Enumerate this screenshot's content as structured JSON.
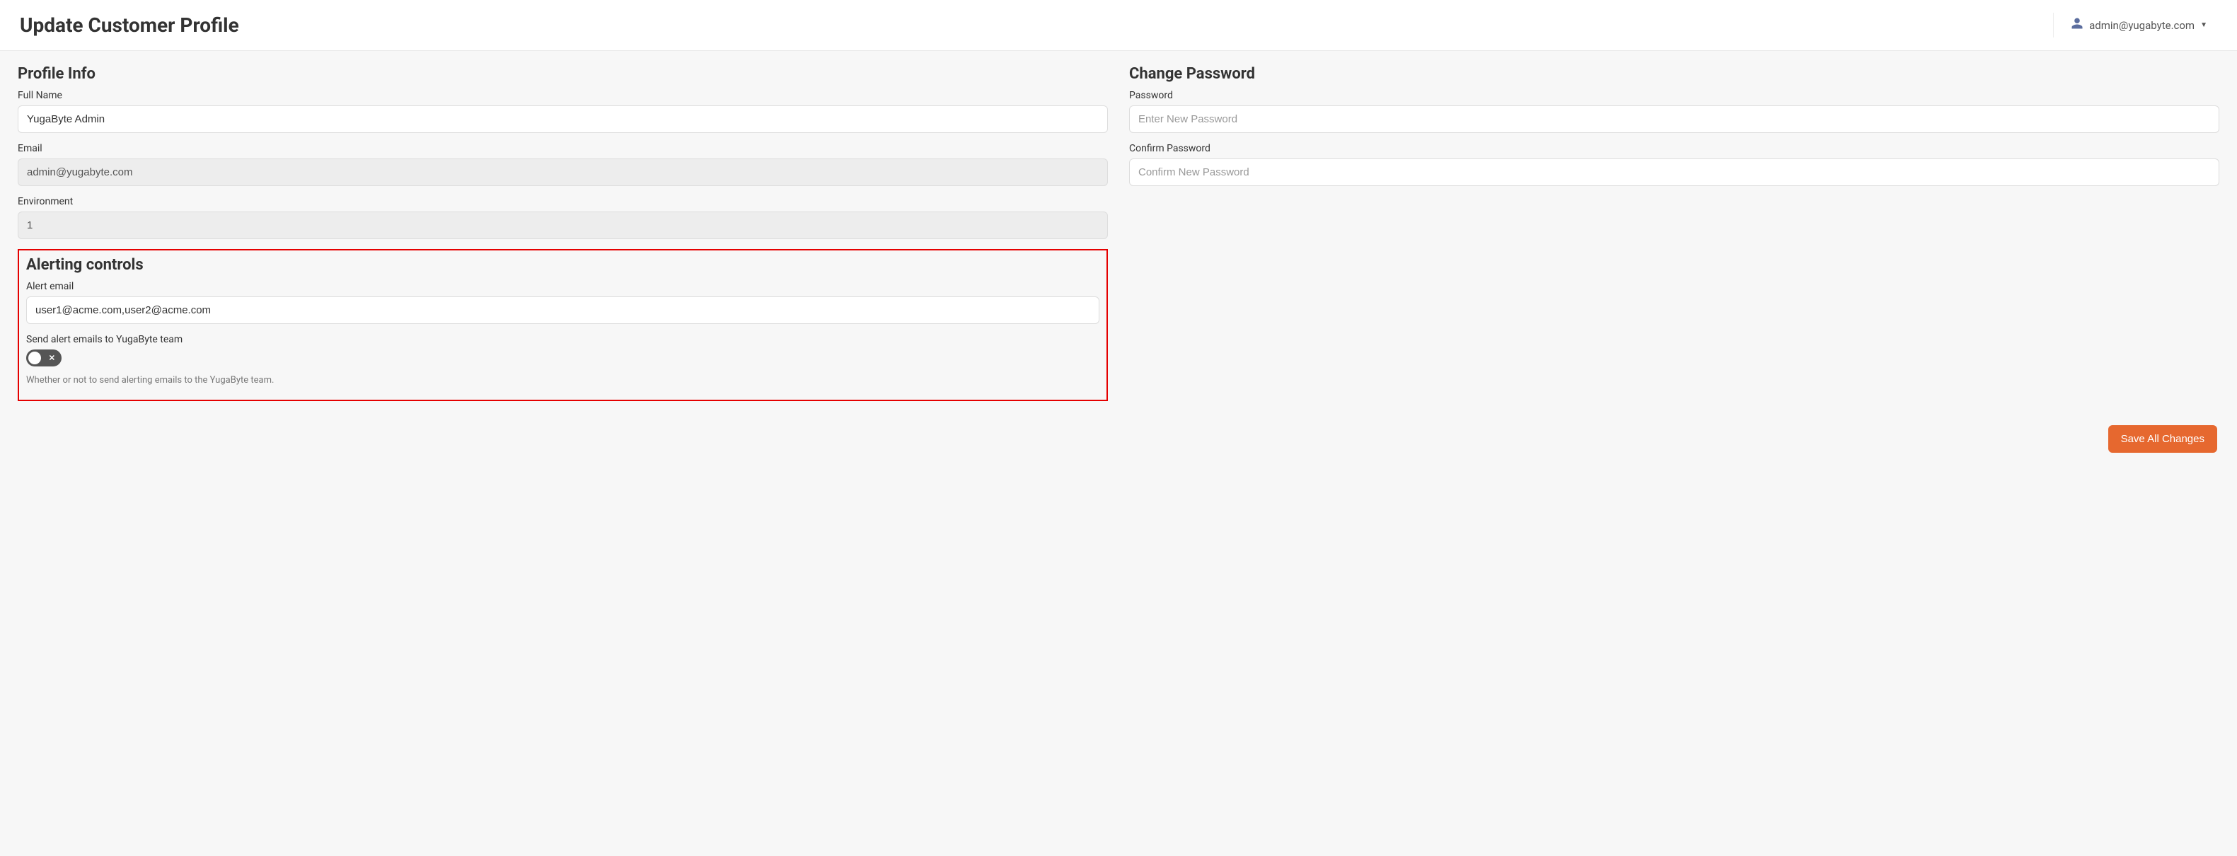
{
  "header": {
    "title": "Update Customer Profile",
    "user_email": "admin@yugabyte.com"
  },
  "profile": {
    "section_title": "Profile Info",
    "full_name_label": "Full Name",
    "full_name_value": "YugaByte Admin",
    "email_label": "Email",
    "email_value": "admin@yugabyte.com",
    "environment_label": "Environment",
    "environment_value": "1"
  },
  "alerting": {
    "section_title": "Alerting controls",
    "alert_email_label": "Alert email",
    "alert_email_value": "user1@acme.com,user2@acme.com",
    "send_to_team_label": "Send alert emails to YugaByte team",
    "send_to_team_value": false,
    "help_text": "Whether or not to send alerting emails to the YugaByte team."
  },
  "password": {
    "section_title": "Change Password",
    "password_label": "Password",
    "password_placeholder": "Enter New Password",
    "confirm_label": "Confirm Password",
    "confirm_placeholder": "Confirm New Password"
  },
  "footer": {
    "save_label": "Save All Changes"
  }
}
